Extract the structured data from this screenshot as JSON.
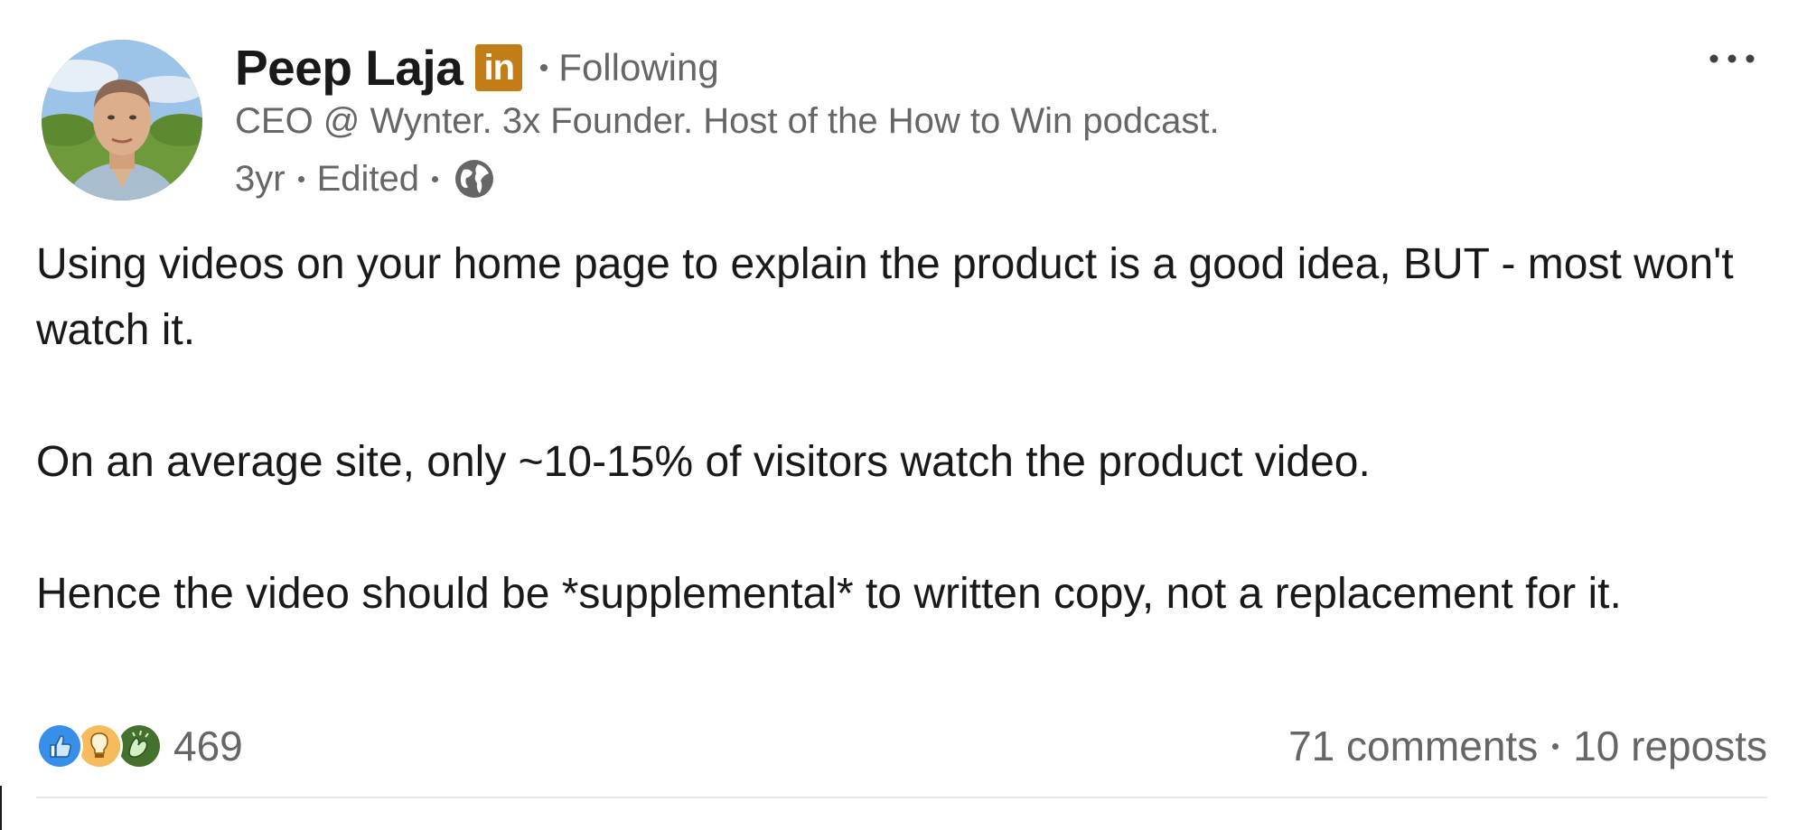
{
  "author": {
    "name": "Peep Laja",
    "badge_text": "in",
    "follow_status": "Following",
    "headline": "CEO @ Wynter. 3x Founder. Host of the How to Win podcast.",
    "age": "3yr",
    "edited": "Edited",
    "visibility_icon": "globe-icon"
  },
  "menu": {
    "more_icon": "more-icon"
  },
  "post": {
    "paragraphs": [
      "Using videos on your home page to explain the product is a good idea, BUT - most won't watch it.",
      "On an average site, only ~10-15% of visitors watch the product video.",
      "Hence the video should be *supplemental* to written copy, not a replacement for it."
    ]
  },
  "social": {
    "reaction_icons": [
      "like-icon",
      "insightful-icon",
      "celebrate-icon"
    ],
    "reaction_count": "469",
    "comments": "71 comments",
    "reposts": "10 reposts"
  },
  "colors": {
    "text_primary": "#191919",
    "text_secondary": "#666666",
    "linkedin_badge": "#c37d16",
    "like_blue": "#378fe9",
    "insightful_yellow": "#f5bb5c",
    "celebrate_green": "#44712e"
  }
}
